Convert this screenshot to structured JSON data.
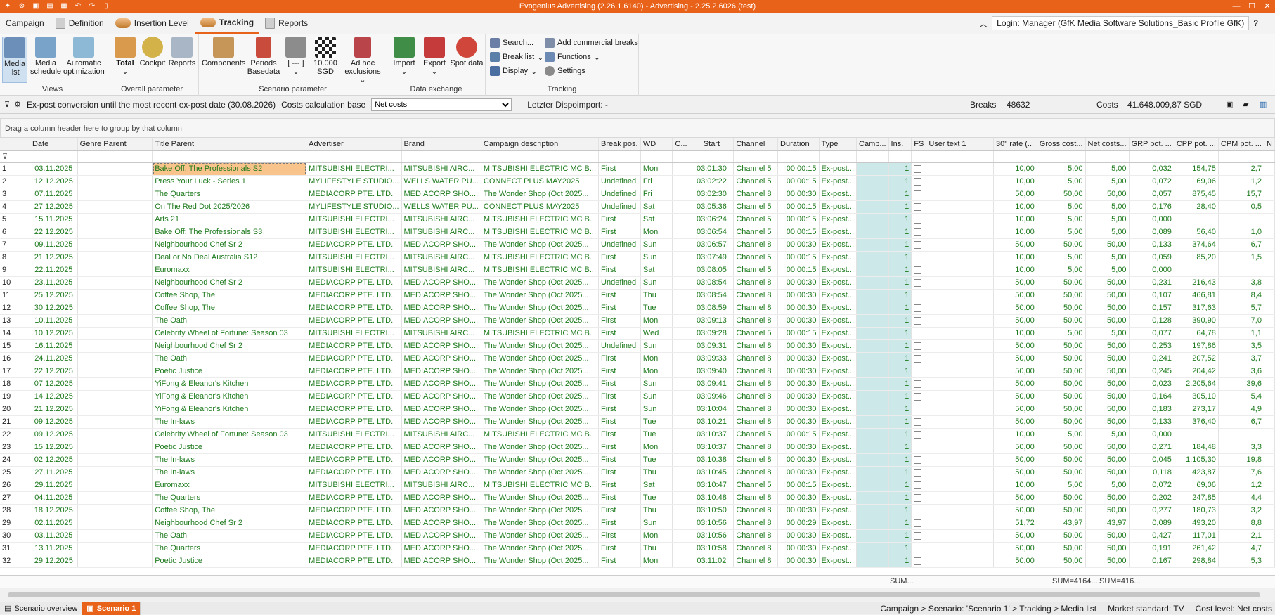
{
  "app": {
    "title": "Evogenius Advertising (2.26.1.6140) - Advertising - 2.25.2.6026 (test)"
  },
  "tabs": [
    "Campaign",
    "Definition",
    "Insertion Level",
    "Tracking",
    "Reports"
  ],
  "login": "Login: Manager (GfK Media Software Solutions_Basic Profile GfK)",
  "ribbon": {
    "views": {
      "label": "Views",
      "media_list": "Media list",
      "media_schedule": "Media schedule",
      "auto_opt": "Automatic optimization"
    },
    "overall": {
      "label": "Overall parameter",
      "total": "Total",
      "cockpit": "Cockpit",
      "reports": "Reports"
    },
    "scenario": {
      "label": "Scenario parameter",
      "components": "Components",
      "periods": "Periods Basedata",
      "bracket": "[ --- ]",
      "sgd": "10.000 SGD",
      "adhoc": "Ad hoc exclusions"
    },
    "exchange": {
      "label": "Data exchange",
      "import": "Import",
      "export": "Export",
      "spot": "Spot data"
    },
    "tracking": {
      "label": "Tracking",
      "search": "Search...",
      "breaklist": "Break list",
      "display": "Display",
      "add_breaks": "Add commercial breaks",
      "functions": "Functions",
      "settings": "Settings"
    }
  },
  "toolbar": {
    "expost": "Ex-post conversion until the most recent ex-post date (30.08.2026)",
    "costs_base": "Costs calculation base",
    "net_costs": "Net costs",
    "dispo": "Letzter Dispoimport: -",
    "breaks_label": "Breaks",
    "breaks_value": "48632",
    "costs_label": "Costs",
    "costs_value": "41.648.009,87 SGD"
  },
  "groupbar": "Drag a column header here to group by that column",
  "columns": [
    "",
    "Date",
    "Genre Parent",
    "Title Parent",
    "Advertiser",
    "Brand",
    "Campaign description",
    "Break pos.",
    "WD",
    "C...",
    "Start",
    "Channel",
    "Duration",
    "Type",
    "Camp...",
    "Ins.",
    "FS",
    "User text 1",
    "30\" rate (...",
    "Gross cost...",
    "Net costs...",
    "GRP pot. ...",
    "CPP pot. ...",
    "CPM pot. ...",
    "N"
  ],
  "rows": [
    [
      "1",
      "03.11.2025",
      "",
      "Bake Off: The Professionals S2",
      "MITSUBISHI ELECTRI...",
      "MITSUBISHI AIRC...",
      "MITSUBISHI ELECTRIC MC B...",
      "First",
      "Mon",
      "",
      "03:01:30",
      "Channel 5",
      "00:00:15",
      "Ex-post...",
      "",
      "1",
      "",
      "",
      "10,00",
      "5,00",
      "5,00",
      "0,032",
      "154,75",
      "2,7"
    ],
    [
      "2",
      "12.12.2025",
      "",
      "Press Your Luck - Series 1",
      "MYLIFESTYLE STUDIO...",
      "WELLS WATER PU...",
      "CONNECT PLUS MAY2025",
      "Undefined",
      "Fri",
      "",
      "03:02:22",
      "Channel 5",
      "00:00:15",
      "Ex-post...",
      "",
      "1",
      "",
      "",
      "10,00",
      "5,00",
      "5,00",
      "0,072",
      "69,06",
      "1,2"
    ],
    [
      "3",
      "07.11.2025",
      "",
      "The Quarters",
      "MEDIACORP PTE. LTD.",
      "MEDIACORP SHO...",
      "The Wonder Shop (Oct 2025...",
      "Undefined",
      "Fri",
      "",
      "03:02:30",
      "Channel 8",
      "00:00:30",
      "Ex-post...",
      "",
      "1",
      "",
      "",
      "50,00",
      "50,00",
      "50,00",
      "0,057",
      "875,45",
      "15,7"
    ],
    [
      "4",
      "27.12.2025",
      "",
      "On The Red Dot 2025/2026",
      "MYLIFESTYLE STUDIO...",
      "WELLS WATER PU...",
      "CONNECT PLUS MAY2025",
      "Undefined",
      "Sat",
      "",
      "03:05:36",
      "Channel 5",
      "00:00:15",
      "Ex-post...",
      "",
      "1",
      "",
      "",
      "10,00",
      "5,00",
      "5,00",
      "0,176",
      "28,40",
      "0,5"
    ],
    [
      "5",
      "15.11.2025",
      "",
      "Arts 21",
      "MITSUBISHI ELECTRI...",
      "MITSUBISHI AIRC...",
      "MITSUBISHI ELECTRIC MC B...",
      "First",
      "Sat",
      "",
      "03:06:24",
      "Channel 5",
      "00:00:15",
      "Ex-post...",
      "",
      "1",
      "",
      "",
      "10,00",
      "5,00",
      "5,00",
      "0,000",
      "",
      ""
    ],
    [
      "6",
      "22.12.2025",
      "",
      "Bake Off: The Professionals S3",
      "MITSUBISHI ELECTRI...",
      "MITSUBISHI AIRC...",
      "MITSUBISHI ELECTRIC MC B...",
      "First",
      "Mon",
      "",
      "03:06:54",
      "Channel 5",
      "00:00:15",
      "Ex-post...",
      "",
      "1",
      "",
      "",
      "10,00",
      "5,00",
      "5,00",
      "0,089",
      "56,40",
      "1,0"
    ],
    [
      "7",
      "09.11.2025",
      "",
      "Neighbourhood Chef Sr 2",
      "MEDIACORP PTE. LTD.",
      "MEDIACORP SHO...",
      "The Wonder Shop (Oct 2025...",
      "Undefined",
      "Sun",
      "",
      "03:06:57",
      "Channel 8",
      "00:00:30",
      "Ex-post...",
      "",
      "1",
      "",
      "",
      "50,00",
      "50,00",
      "50,00",
      "0,133",
      "374,64",
      "6,7"
    ],
    [
      "8",
      "21.12.2025",
      "",
      "Deal or No Deal Australia S12",
      "MITSUBISHI ELECTRI...",
      "MITSUBISHI AIRC...",
      "MITSUBISHI ELECTRIC MC B...",
      "First",
      "Sun",
      "",
      "03:07:49",
      "Channel 5",
      "00:00:15",
      "Ex-post...",
      "",
      "1",
      "",
      "",
      "10,00",
      "5,00",
      "5,00",
      "0,059",
      "85,20",
      "1,5"
    ],
    [
      "9",
      "22.11.2025",
      "",
      "Euromaxx",
      "MITSUBISHI ELECTRI...",
      "MITSUBISHI AIRC...",
      "MITSUBISHI ELECTRIC MC B...",
      "First",
      "Sat",
      "",
      "03:08:05",
      "Channel 5",
      "00:00:15",
      "Ex-post...",
      "",
      "1",
      "",
      "",
      "10,00",
      "5,00",
      "5,00",
      "0,000",
      "",
      ""
    ],
    [
      "10",
      "23.11.2025",
      "",
      "Neighbourhood Chef Sr 2",
      "MEDIACORP PTE. LTD.",
      "MEDIACORP SHO...",
      "The Wonder Shop (Oct 2025...",
      "Undefined",
      "Sun",
      "",
      "03:08:54",
      "Channel 8",
      "00:00:30",
      "Ex-post...",
      "",
      "1",
      "",
      "",
      "50,00",
      "50,00",
      "50,00",
      "0,231",
      "216,43",
      "3,8"
    ],
    [
      "11",
      "25.12.2025",
      "",
      "Coffee Shop, The",
      "MEDIACORP PTE. LTD.",
      "MEDIACORP SHO...",
      "The Wonder Shop (Oct 2025...",
      "First",
      "Thu",
      "",
      "03:08:54",
      "Channel 8",
      "00:00:30",
      "Ex-post...",
      "",
      "1",
      "",
      "",
      "50,00",
      "50,00",
      "50,00",
      "0,107",
      "466,81",
      "8,4"
    ],
    [
      "12",
      "30.12.2025",
      "",
      "Coffee Shop, The",
      "MEDIACORP PTE. LTD.",
      "MEDIACORP SHO...",
      "The Wonder Shop (Oct 2025...",
      "First",
      "Tue",
      "",
      "03:08:59",
      "Channel 8",
      "00:00:30",
      "Ex-post...",
      "",
      "1",
      "",
      "",
      "50,00",
      "50,00",
      "50,00",
      "0,157",
      "317,63",
      "5,7"
    ],
    [
      "13",
      "10.11.2025",
      "",
      "The Oath",
      "MEDIACORP PTE. LTD.",
      "MEDIACORP SHO...",
      "The Wonder Shop (Oct 2025...",
      "First",
      "Mon",
      "",
      "03:09:13",
      "Channel 8",
      "00:00:30",
      "Ex-post...",
      "",
      "1",
      "",
      "",
      "50,00",
      "50,00",
      "50,00",
      "0,128",
      "390,90",
      "7,0"
    ],
    [
      "14",
      "10.12.2025",
      "",
      "Celebrity Wheel of Fortune: Season 03",
      "MITSUBISHI ELECTRI...",
      "MITSUBISHI AIRC...",
      "MITSUBISHI ELECTRIC MC B...",
      "First",
      "Wed",
      "",
      "03:09:28",
      "Channel 5",
      "00:00:15",
      "Ex-post...",
      "",
      "1",
      "",
      "",
      "10,00",
      "5,00",
      "5,00",
      "0,077",
      "64,78",
      "1,1"
    ],
    [
      "15",
      "16.11.2025",
      "",
      "Neighbourhood Chef Sr 2",
      "MEDIACORP PTE. LTD.",
      "MEDIACORP SHO...",
      "The Wonder Shop (Oct 2025...",
      "Undefined",
      "Sun",
      "",
      "03:09:31",
      "Channel 8",
      "00:00:30",
      "Ex-post...",
      "",
      "1",
      "",
      "",
      "50,00",
      "50,00",
      "50,00",
      "0,253",
      "197,86",
      "3,5"
    ],
    [
      "16",
      "24.11.2025",
      "",
      "The Oath",
      "MEDIACORP PTE. LTD.",
      "MEDIACORP SHO...",
      "The Wonder Shop (Oct 2025...",
      "First",
      "Mon",
      "",
      "03:09:33",
      "Channel 8",
      "00:00:30",
      "Ex-post...",
      "",
      "1",
      "",
      "",
      "50,00",
      "50,00",
      "50,00",
      "0,241",
      "207,52",
      "3,7"
    ],
    [
      "17",
      "22.12.2025",
      "",
      "Poetic Justice",
      "MEDIACORP PTE. LTD.",
      "MEDIACORP SHO...",
      "The Wonder Shop (Oct 2025...",
      "First",
      "Mon",
      "",
      "03:09:40",
      "Channel 8",
      "00:00:30",
      "Ex-post...",
      "",
      "1",
      "",
      "",
      "50,00",
      "50,00",
      "50,00",
      "0,245",
      "204,42",
      "3,6"
    ],
    [
      "18",
      "07.12.2025",
      "",
      "YiFong & Eleanor's Kitchen",
      "MEDIACORP PTE. LTD.",
      "MEDIACORP SHO...",
      "The Wonder Shop (Oct 2025...",
      "First",
      "Sun",
      "",
      "03:09:41",
      "Channel 8",
      "00:00:30",
      "Ex-post...",
      "",
      "1",
      "",
      "",
      "50,00",
      "50,00",
      "50,00",
      "0,023",
      "2.205,64",
      "39,6"
    ],
    [
      "19",
      "14.12.2025",
      "",
      "YiFong & Eleanor's Kitchen",
      "MEDIACORP PTE. LTD.",
      "MEDIACORP SHO...",
      "The Wonder Shop (Oct 2025...",
      "First",
      "Sun",
      "",
      "03:09:46",
      "Channel 8",
      "00:00:30",
      "Ex-post...",
      "",
      "1",
      "",
      "",
      "50,00",
      "50,00",
      "50,00",
      "0,164",
      "305,10",
      "5,4"
    ],
    [
      "20",
      "21.12.2025",
      "",
      "YiFong & Eleanor's Kitchen",
      "MEDIACORP PTE. LTD.",
      "MEDIACORP SHO...",
      "The Wonder Shop (Oct 2025...",
      "First",
      "Sun",
      "",
      "03:10:04",
      "Channel 8",
      "00:00:30",
      "Ex-post...",
      "",
      "1",
      "",
      "",
      "50,00",
      "50,00",
      "50,00",
      "0,183",
      "273,17",
      "4,9"
    ],
    [
      "21",
      "09.12.2025",
      "",
      "The In-laws",
      "MEDIACORP PTE. LTD.",
      "MEDIACORP SHO...",
      "The Wonder Shop (Oct 2025...",
      "First",
      "Tue",
      "",
      "03:10:21",
      "Channel 8",
      "00:00:30",
      "Ex-post...",
      "",
      "1",
      "",
      "",
      "50,00",
      "50,00",
      "50,00",
      "0,133",
      "376,40",
      "6,7"
    ],
    [
      "22",
      "09.12.2025",
      "",
      "Celebrity Wheel of Fortune: Season 03",
      "MITSUBISHI ELECTRI...",
      "MITSUBISHI AIRC...",
      "MITSUBISHI ELECTRIC MC B...",
      "First",
      "Tue",
      "",
      "03:10:37",
      "Channel 5",
      "00:00:15",
      "Ex-post...",
      "",
      "1",
      "",
      "",
      "10,00",
      "5,00",
      "5,00",
      "0,000",
      "",
      ""
    ],
    [
      "23",
      "15.12.2025",
      "",
      "Poetic Justice",
      "MEDIACORP PTE. LTD.",
      "MEDIACORP SHO...",
      "The Wonder Shop (Oct 2025...",
      "First",
      "Mon",
      "",
      "03:10:37",
      "Channel 8",
      "00:00:30",
      "Ex-post...",
      "",
      "1",
      "",
      "",
      "50,00",
      "50,00",
      "50,00",
      "0,271",
      "184,48",
      "3,3"
    ],
    [
      "24",
      "02.12.2025",
      "",
      "The In-laws",
      "MEDIACORP PTE. LTD.",
      "MEDIACORP SHO...",
      "The Wonder Shop (Oct 2025...",
      "First",
      "Tue",
      "",
      "03:10:38",
      "Channel 8",
      "00:00:30",
      "Ex-post...",
      "",
      "1",
      "",
      "",
      "50,00",
      "50,00",
      "50,00",
      "0,045",
      "1.105,30",
      "19,8"
    ],
    [
      "25",
      "27.11.2025",
      "",
      "The In-laws",
      "MEDIACORP PTE. LTD.",
      "MEDIACORP SHO...",
      "The Wonder Shop (Oct 2025...",
      "First",
      "Thu",
      "",
      "03:10:45",
      "Channel 8",
      "00:00:30",
      "Ex-post...",
      "",
      "1",
      "",
      "",
      "50,00",
      "50,00",
      "50,00",
      "0,118",
      "423,87",
      "7,6"
    ],
    [
      "26",
      "29.11.2025",
      "",
      "Euromaxx",
      "MITSUBISHI ELECTRI...",
      "MITSUBISHI AIRC...",
      "MITSUBISHI ELECTRIC MC B...",
      "First",
      "Sat",
      "",
      "03:10:47",
      "Channel 5",
      "00:00:15",
      "Ex-post...",
      "",
      "1",
      "",
      "",
      "10,00",
      "5,00",
      "5,00",
      "0,072",
      "69,06",
      "1,2"
    ],
    [
      "27",
      "04.11.2025",
      "",
      "The Quarters",
      "MEDIACORP PTE. LTD.",
      "MEDIACORP SHO...",
      "The Wonder Shop (Oct 2025...",
      "First",
      "Tue",
      "",
      "03:10:48",
      "Channel 8",
      "00:00:30",
      "Ex-post...",
      "",
      "1",
      "",
      "",
      "50,00",
      "50,00",
      "50,00",
      "0,202",
      "247,85",
      "4,4"
    ],
    [
      "28",
      "18.12.2025",
      "",
      "Coffee Shop, The",
      "MEDIACORP PTE. LTD.",
      "MEDIACORP SHO...",
      "The Wonder Shop (Oct 2025...",
      "First",
      "Thu",
      "",
      "03:10:50",
      "Channel 8",
      "00:00:30",
      "Ex-post...",
      "",
      "1",
      "",
      "",
      "50,00",
      "50,00",
      "50,00",
      "0,277",
      "180,73",
      "3,2"
    ],
    [
      "29",
      "02.11.2025",
      "",
      "Neighbourhood Chef Sr 2",
      "MEDIACORP PTE. LTD.",
      "MEDIACORP SHO...",
      "The Wonder Shop (Oct 2025...",
      "First",
      "Sun",
      "",
      "03:10:56",
      "Channel 8",
      "00:00:29",
      "Ex-post...",
      "",
      "1",
      "",
      "",
      "51,72",
      "43,97",
      "43,97",
      "0,089",
      "493,20",
      "8,8"
    ],
    [
      "30",
      "03.11.2025",
      "",
      "The Oath",
      "MEDIACORP PTE. LTD.",
      "MEDIACORP SHO...",
      "The Wonder Shop (Oct 2025...",
      "First",
      "Mon",
      "",
      "03:10:56",
      "Channel 8",
      "00:00:30",
      "Ex-post...",
      "",
      "1",
      "",
      "",
      "50,00",
      "50,00",
      "50,00",
      "0,427",
      "117,01",
      "2,1"
    ],
    [
      "31",
      "13.11.2025",
      "",
      "The Quarters",
      "MEDIACORP PTE. LTD.",
      "MEDIACORP SHO...",
      "The Wonder Shop (Oct 2025...",
      "First",
      "Thu",
      "",
      "03:10:58",
      "Channel 8",
      "00:00:30",
      "Ex-post...",
      "",
      "1",
      "",
      "",
      "50,00",
      "50,00",
      "50,00",
      "0,191",
      "261,42",
      "4,7"
    ],
    [
      "32",
      "29.12.2025",
      "",
      "Poetic Justice",
      "MEDIACORP PTE. LTD.",
      "MEDIACORP SHO...",
      "The Wonder Shop (Oct 2025...",
      "First",
      "Mon",
      "",
      "03:11:02",
      "Channel 8",
      "00:00:30",
      "Ex-post...",
      "",
      "1",
      "",
      "",
      "50,00",
      "50,00",
      "50,00",
      "0,167",
      "298,84",
      "5,3"
    ]
  ],
  "sums": {
    "s1": "SUM...",
    "s2": "SUM=4164...",
    "s3": "SUM=416..."
  },
  "statusbar": {
    "tab1": "Scenario overview",
    "tab2": "Scenario 1",
    "crumb": "Campaign > Scenario: 'Scenario 1' > Tracking > Media list",
    "market": "Market standard: TV",
    "cost_level": "Cost level: Net costs"
  }
}
